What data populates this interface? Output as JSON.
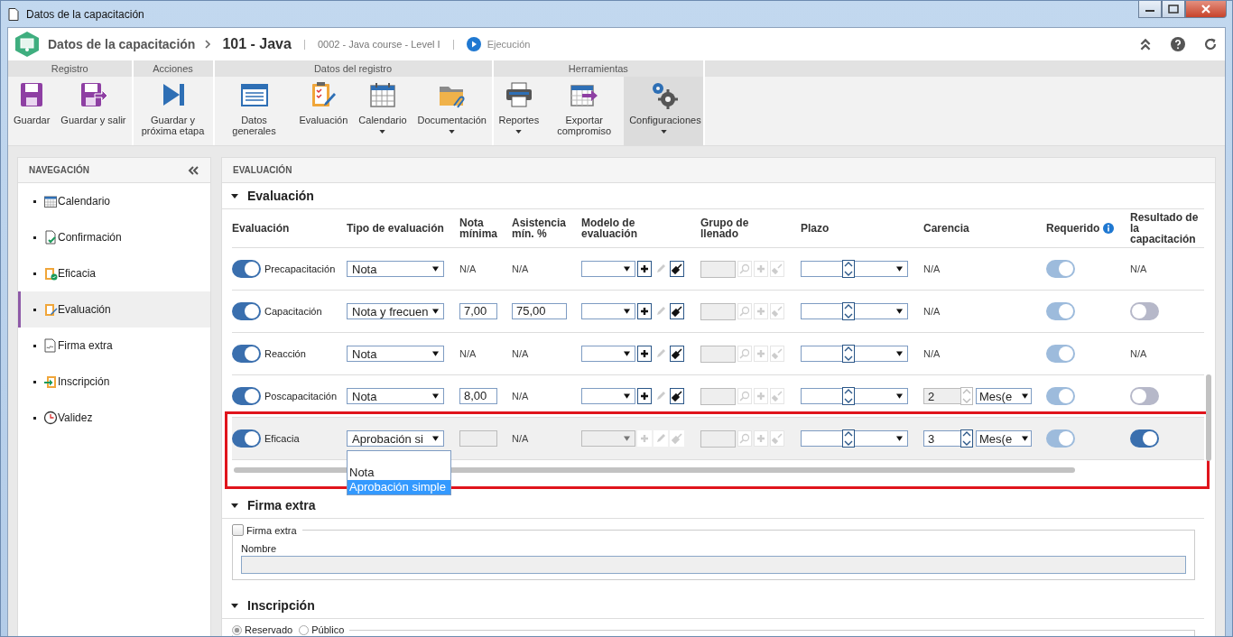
{
  "window": {
    "title": "Datos de la capacitación"
  },
  "header": {
    "title": "Datos de la capacitación",
    "record": "101 - Java",
    "course": "0002 - Java course - Level I",
    "status": "Ejecución"
  },
  "ribbon": [
    {
      "label": "Registro",
      "buttons": [
        {
          "label": "Guardar",
          "dropdown": false,
          "selected": false
        },
        {
          "label": "Guardar y salir",
          "dropdown": false,
          "selected": false
        }
      ]
    },
    {
      "label": "Acciones",
      "buttons": [
        {
          "label": "Guardar y próxima etapa",
          "dropdown": false,
          "selected": false
        }
      ]
    },
    {
      "label": "Datos del registro",
      "buttons": [
        {
          "label": "Datos generales",
          "dropdown": false,
          "selected": false
        },
        {
          "label": "Evaluación",
          "dropdown": false,
          "selected": false
        },
        {
          "label": "Calendario",
          "dropdown": true,
          "selected": false
        },
        {
          "label": "Documentación",
          "dropdown": true,
          "selected": false
        }
      ]
    },
    {
      "label": "Herramientas",
      "buttons": [
        {
          "label": "Reportes",
          "dropdown": true,
          "selected": false
        },
        {
          "label": "Exportar compromiso",
          "dropdown": false,
          "selected": false
        },
        {
          "label": "Configuraciones",
          "dropdown": true,
          "selected": true
        }
      ]
    }
  ],
  "sidebar": {
    "title": "NAVEGACIÓN",
    "items": [
      {
        "label": "Calendario",
        "selected": false
      },
      {
        "label": "Confirmación",
        "selected": false
      },
      {
        "label": "Eficacia",
        "selected": false
      },
      {
        "label": "Evaluación",
        "selected": true
      },
      {
        "label": "Firma extra",
        "selected": false
      },
      {
        "label": "Inscripción",
        "selected": false
      },
      {
        "label": "Validez",
        "selected": false
      }
    ]
  },
  "panel": {
    "title": "EVALUACIÓN"
  },
  "evaluation": {
    "title": "Evaluación",
    "expanded": true,
    "columns": [
      "Evaluación",
      "Tipo de evaluación",
      "Nota mínima",
      "Asistencia mín. %",
      "Modelo de evaluación",
      "Grupo de llenado",
      "Plazo",
      "Carencia",
      "Requerido",
      "Resultado de la capacitación"
    ],
    "rows": [
      {
        "name": "Precapacitación",
        "on": true,
        "selected": false,
        "highlighted": false,
        "type": "Nota",
        "nota": {
          "kind": "na",
          "text": "N/A"
        },
        "asistencia": {
          "kind": "na",
          "text": "N/A"
        },
        "modelo_disabled": false,
        "carencia": {
          "kind": "na",
          "text": "N/A"
        },
        "required": true,
        "result": {
          "kind": "na",
          "text": "N/A"
        }
      },
      {
        "name": "Capacitación",
        "on": true,
        "selected": false,
        "highlighted": false,
        "type": "Nota y frecuen",
        "nota": {
          "kind": "input",
          "text": "7,00"
        },
        "asistencia": {
          "kind": "input",
          "text": "75,00"
        },
        "modelo_disabled": false,
        "carencia": {
          "kind": "na",
          "text": "N/A"
        },
        "required": true,
        "result": {
          "kind": "toggle",
          "on": false
        }
      },
      {
        "name": "Reacción",
        "on": true,
        "selected": false,
        "highlighted": false,
        "type": "Nota",
        "nota": {
          "kind": "na",
          "text": "N/A"
        },
        "asistencia": {
          "kind": "na",
          "text": "N/A"
        },
        "modelo_disabled": false,
        "carencia": {
          "kind": "na",
          "text": "N/A"
        },
        "required": true,
        "result": {
          "kind": "na",
          "text": "N/A"
        }
      },
      {
        "name": "Poscapacitación",
        "on": true,
        "selected": false,
        "highlighted": false,
        "type": "Nota",
        "nota": {
          "kind": "input",
          "text": "8,00"
        },
        "asistencia": {
          "kind": "na",
          "text": "N/A"
        },
        "modelo_disabled": false,
        "carencia": {
          "kind": "period",
          "text": "2",
          "unit": "Mes(e",
          "disabled": true
        },
        "required": true,
        "result": {
          "kind": "toggle",
          "on": false
        }
      },
      {
        "name": "Eficacia",
        "on": true,
        "selected": true,
        "highlighted": true,
        "type": "Aprobación si",
        "nota": {
          "kind": "empty"
        },
        "asistencia": {
          "kind": "na",
          "text": "N/A"
        },
        "modelo_disabled": true,
        "carencia": {
          "kind": "period",
          "text": "3",
          "unit": "Mes(e",
          "disabled": false
        },
        "required": true,
        "result": {
          "kind": "toggle",
          "on": true
        },
        "options": [
          {
            "label": "Nota",
            "selected": false
          },
          {
            "label": "Aprobación simple",
            "selected": true
          }
        ]
      }
    ]
  },
  "firma": {
    "title": "Firma extra",
    "expanded": true,
    "checkbox": {
      "label": "Firma extra",
      "checked": false
    },
    "field_label": "Nombre"
  },
  "inscripcion": {
    "title": "Inscripción",
    "expanded": true,
    "radios": [
      {
        "label": "Reservado",
        "selected": true
      },
      {
        "label": "Público",
        "selected": false
      }
    ]
  }
}
